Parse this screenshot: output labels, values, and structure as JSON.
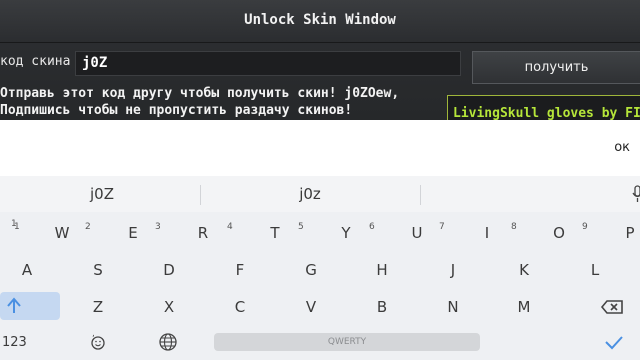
{
  "game": {
    "title": "Unlock Skin Window",
    "code_label": "код скина",
    "code_value": "j0Z",
    "get_button": "получить",
    "message_line1": "Отправь этот код другу чтобы получить скин! j0ZOew,",
    "message_line2": "Подпишись чтобы не пропустить раздачу скинов!",
    "skin_name": "LivingSkull gloves by FIR"
  },
  "ok_bar": {
    "ok_label": "ок"
  },
  "keyboard": {
    "suggestions": [
      "j0Z",
      "j0z"
    ],
    "row1": [
      {
        "k": "W",
        "h": "1"
      },
      {
        "k": "E",
        "h": "2"
      },
      {
        "k": "R",
        "h": "3"
      },
      {
        "k": "T",
        "h": "4"
      },
      {
        "k": "Y",
        "h": "5"
      },
      {
        "k": "U",
        "h": "6"
      },
      {
        "k": "I",
        "h": "7"
      },
      {
        "k": "O",
        "h": "8"
      },
      {
        "k": "P",
        "h": "9"
      }
    ],
    "row2": [
      "A",
      "S",
      "D",
      "F",
      "G",
      "H",
      "J",
      "K",
      "L"
    ],
    "row3": [
      "Z",
      "X",
      "C",
      "V",
      "B",
      "N",
      "M"
    ],
    "numbers_key": "123",
    "emoji_hint": ",",
    "space_label": "QWERTY",
    "shift_icon": "shift-arrow-icon",
    "backspace_icon": "backspace-icon",
    "enter_icon": "checkmark-icon",
    "accent_color": "#4a90e2"
  }
}
